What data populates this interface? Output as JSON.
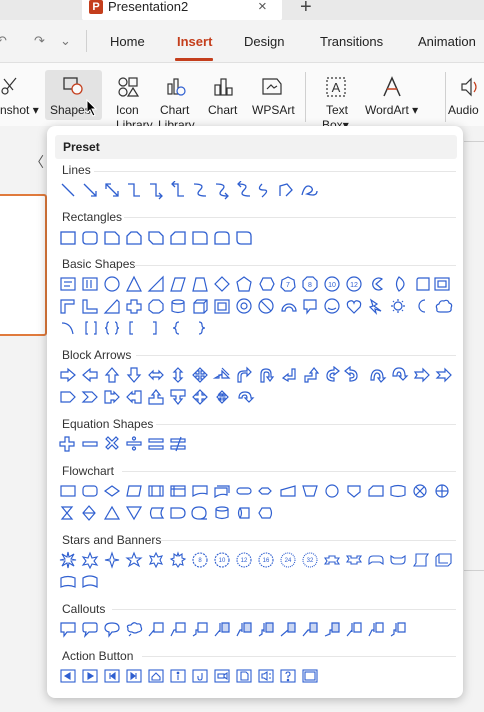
{
  "window": {
    "doc_tab_title": "Presentation2",
    "app_logo": "P"
  },
  "menu": {
    "items": [
      "Home",
      "Insert",
      "Design",
      "Transitions",
      "Animation"
    ],
    "active": "Insert"
  },
  "ribbon": {
    "screenshot_label": "nshot",
    "shapes_label": "Shapes",
    "icon_library_label": "Icon",
    "icon_library_label2": "Library",
    "chart_library_label": "Chart",
    "chart_library_label2": "Library",
    "chart_label": "Chart",
    "wpsart_label": "WPSArt",
    "textbox_label": "Text",
    "textbox_label2": "Box",
    "wordart_label": "WordArt",
    "audio_label": "Audio",
    "chevron": "▾"
  },
  "shapes_panel": {
    "header": "Preset",
    "categories": {
      "lines": "Lines",
      "rectangles": "Rectangles",
      "basic_shapes": "Basic Shapes",
      "block_arrows": "Block Arrows",
      "equation_shapes": "Equation Shapes",
      "flowchart": "Flowchart",
      "stars_banners": "Stars and Banners",
      "callouts": "Callouts",
      "action_button": "Action Button"
    },
    "star_labels": [
      "8",
      "10",
      "12",
      "16",
      "24",
      "32"
    ],
    "basic_text_labels": [
      "7",
      "8",
      "10",
      "12"
    ]
  },
  "colors": {
    "accent": "#c43e1c",
    "shape_icon": "#2f5fd0",
    "selection_border": "#e07a3c"
  },
  "icons": [
    "undo-icon",
    "redo-icon",
    "chevron-down-icon",
    "close-icon",
    "plus-icon",
    "chevron-left-icon",
    "cursor-icon",
    "speaker-icon"
  ]
}
